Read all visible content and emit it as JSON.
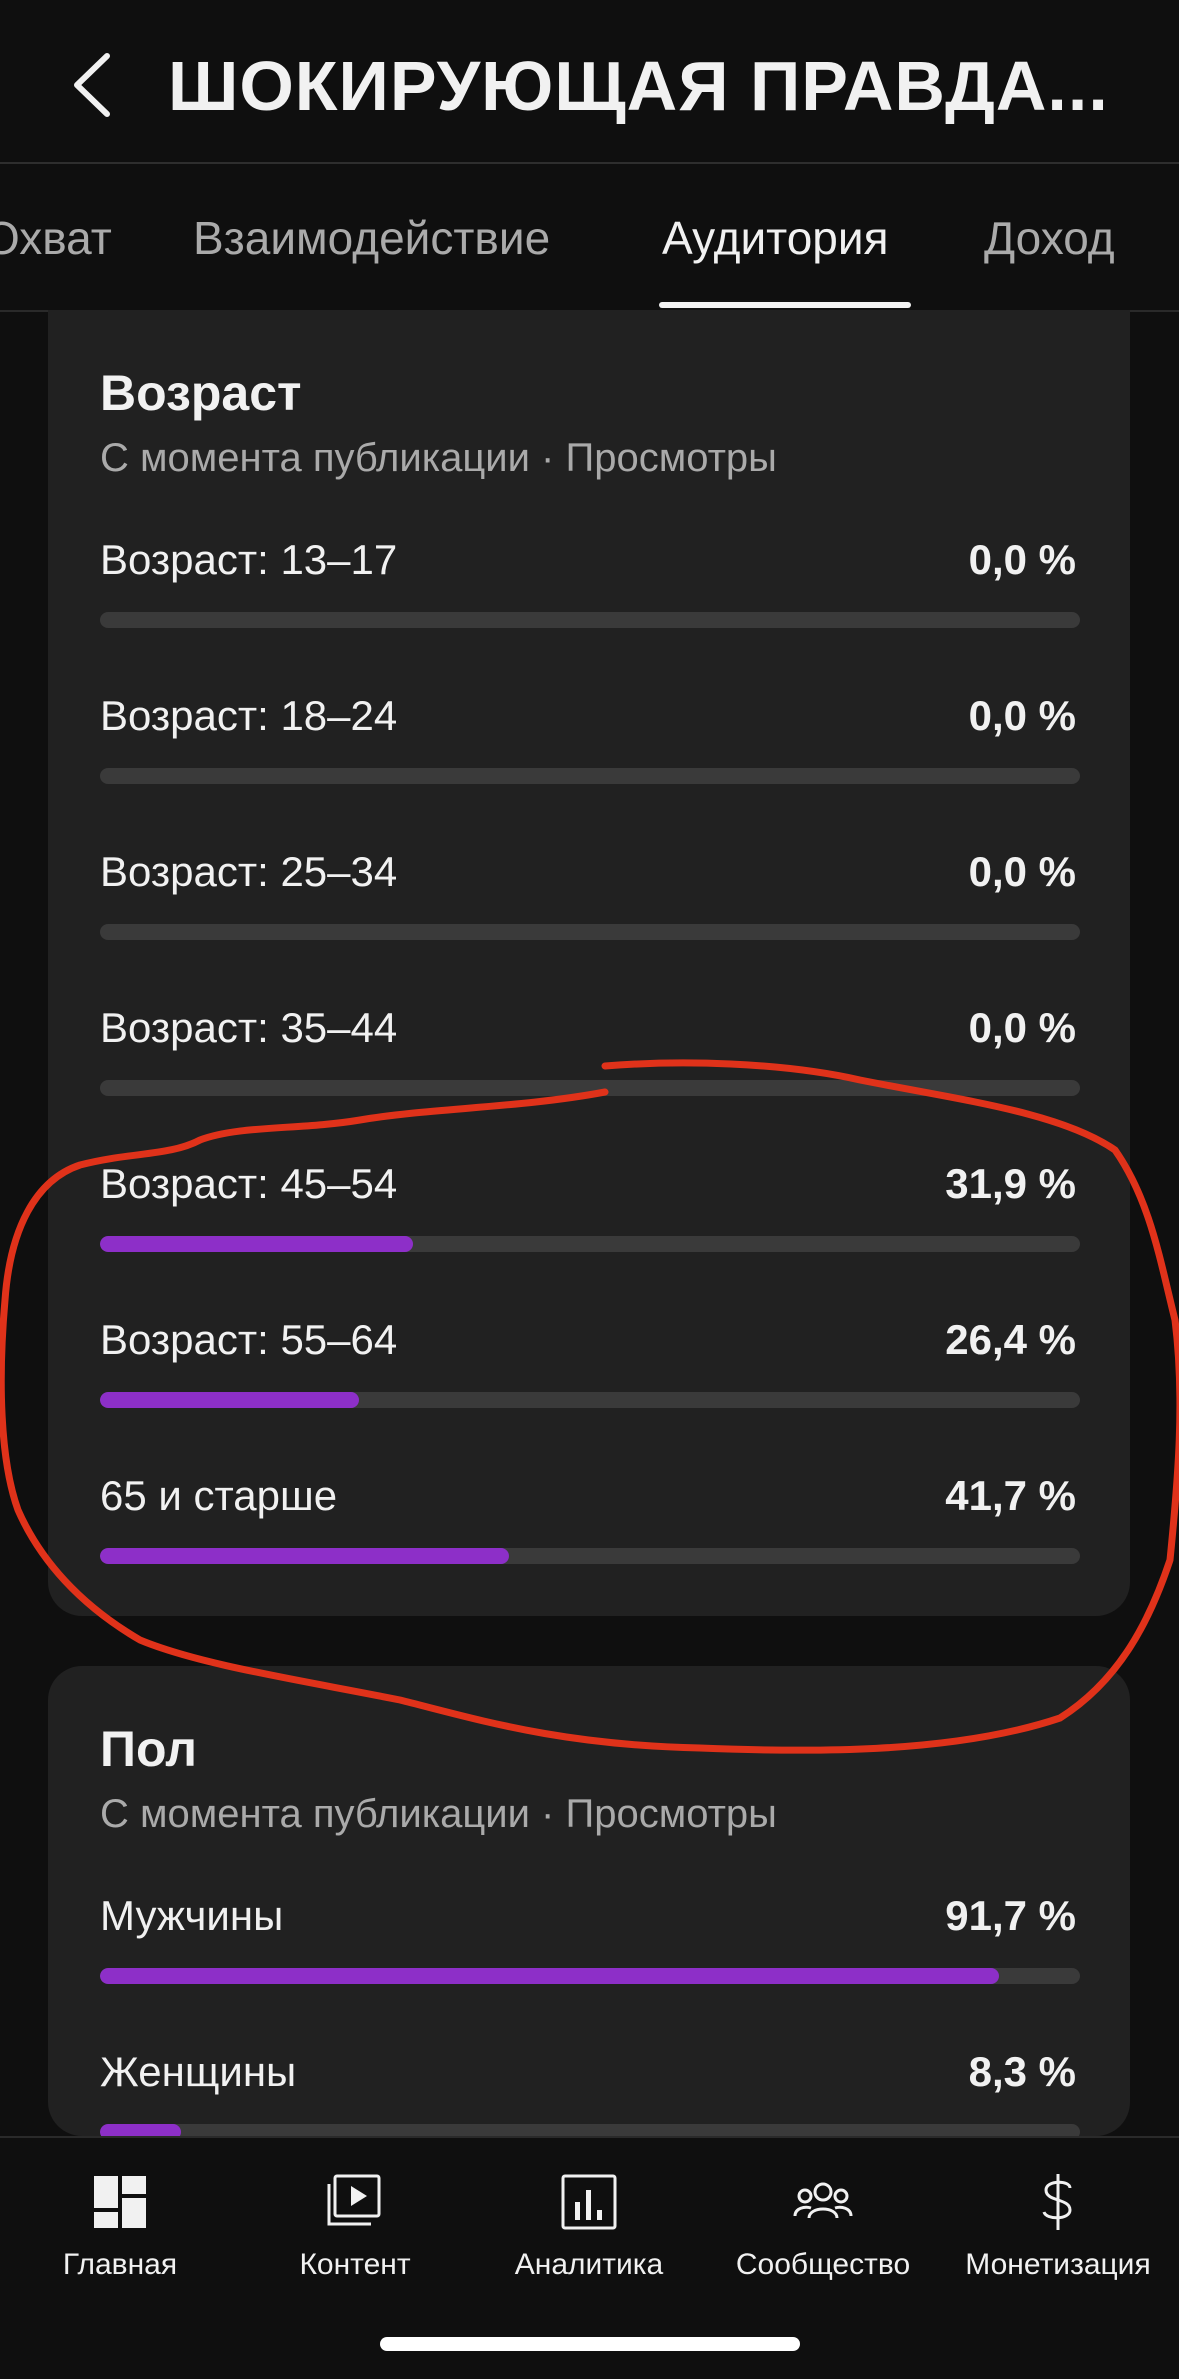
{
  "header": {
    "title": "ШОКИРУЮЩАЯ ПРАВДА..."
  },
  "tabs": [
    {
      "label": "Охват",
      "active": false
    },
    {
      "label": "Взаимодействие",
      "active": false
    },
    {
      "label": "Аудитория",
      "active": true
    },
    {
      "label": "Доход",
      "active": false
    }
  ],
  "age_card": {
    "title": "Возраст",
    "subtitle": "С момента публикации · Просмотры",
    "rows": [
      {
        "label": "Возраст: 13–17",
        "value": "0,0 %",
        "percent": 0.0
      },
      {
        "label": "Возраст: 18–24",
        "value": "0,0 %",
        "percent": 0.0
      },
      {
        "label": "Возраст: 25–34",
        "value": "0,0 %",
        "percent": 0.0
      },
      {
        "label": "Возраст: 35–44",
        "value": "0,0 %",
        "percent": 0.0
      },
      {
        "label": "Возраст: 45–54",
        "value": "31,9 %",
        "percent": 31.9
      },
      {
        "label": "Возраст: 55–64",
        "value": "26,4 %",
        "percent": 26.4
      },
      {
        "label": "65 и старше",
        "value": "41,7 %",
        "percent": 41.7
      }
    ]
  },
  "gender_card": {
    "title": "Пол",
    "subtitle": "С момента публикации · Просмотры",
    "rows": [
      {
        "label": "Мужчины",
        "value": "91,7 %",
        "percent": 91.7
      },
      {
        "label": "Женщины",
        "value": "8,3 %",
        "percent": 8.3
      }
    ]
  },
  "bottom_nav": [
    {
      "label": "Главная",
      "icon": "dashboard-icon"
    },
    {
      "label": "Контент",
      "icon": "content-icon"
    },
    {
      "label": "Аналитика",
      "icon": "analytics-icon"
    },
    {
      "label": "Сообщество",
      "icon": "community-icon"
    },
    {
      "label": "Монетизация",
      "icon": "monetization-icon"
    }
  ],
  "colors": {
    "background": "#0f0f0f",
    "card": "#212121",
    "bar_track": "#3a3a3a",
    "bar_fill": "#8d2fc8",
    "annotation_stroke": "#e0321a"
  }
}
